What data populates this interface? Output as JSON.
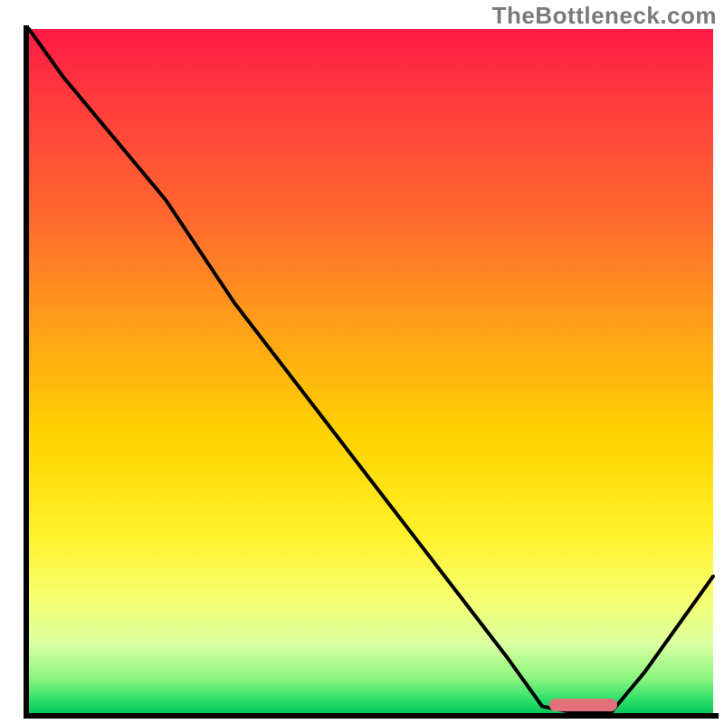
{
  "watermark": "TheBottleneck.com",
  "colors": {
    "gradient_top": "#ff1a46",
    "gradient_mid1": "#ffa516",
    "gradient_mid2": "#fff12a",
    "gradient_bottom": "#09c75c",
    "curve": "#000000",
    "marker": "#e4717a",
    "axis": "#000000"
  },
  "chart_data": {
    "type": "line",
    "title": "",
    "xlabel": "",
    "ylabel": "",
    "xlim": [
      0,
      100
    ],
    "ylim": [
      0,
      100
    ],
    "grid": false,
    "legend": false,
    "x": [
      0,
      5,
      10,
      15,
      20,
      22,
      30,
      40,
      50,
      60,
      70,
      75,
      80,
      85,
      90,
      95,
      100
    ],
    "values": [
      100,
      93,
      87,
      81,
      75,
      72,
      60,
      47,
      34,
      21,
      8,
      1,
      0,
      0,
      6,
      13,
      20
    ],
    "marker": {
      "x_start": 76,
      "x_end": 86,
      "y": 0
    },
    "annotations": []
  }
}
